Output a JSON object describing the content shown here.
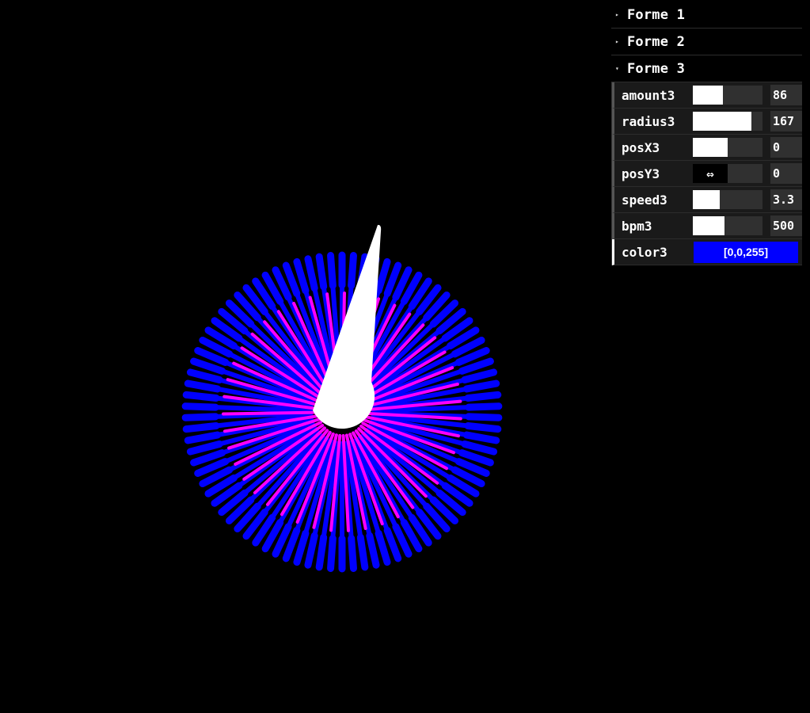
{
  "gui": {
    "folders": [
      {
        "label": "Forme 1",
        "open": false
      },
      {
        "label": "Forme 2",
        "open": false
      },
      {
        "label": "Forme 3",
        "open": true
      }
    ],
    "controllers": [
      {
        "label": "amount3",
        "value": "86",
        "fill": 0.43
      },
      {
        "label": "radius3",
        "value": "167",
        "fill": 0.84
      },
      {
        "label": "posX3",
        "value": "0",
        "fill": 0.5
      },
      {
        "label": "posY3",
        "value": "0",
        "fill": 0.5
      },
      {
        "label": "speed3",
        "value": "3.3",
        "fill": 0.39
      },
      {
        "label": "bpm3",
        "value": "500",
        "fill": 0.45
      }
    ],
    "color": {
      "label": "color3",
      "value": "[0,0,255]",
      "hex": "#0000ff"
    }
  },
  "artwork": {
    "outer_color": "#0000ff",
    "inner_color": "#ff00ff",
    "needle_color": "#ffffff",
    "outer_spoke_count": 86,
    "inner_spoke_count": 43
  }
}
